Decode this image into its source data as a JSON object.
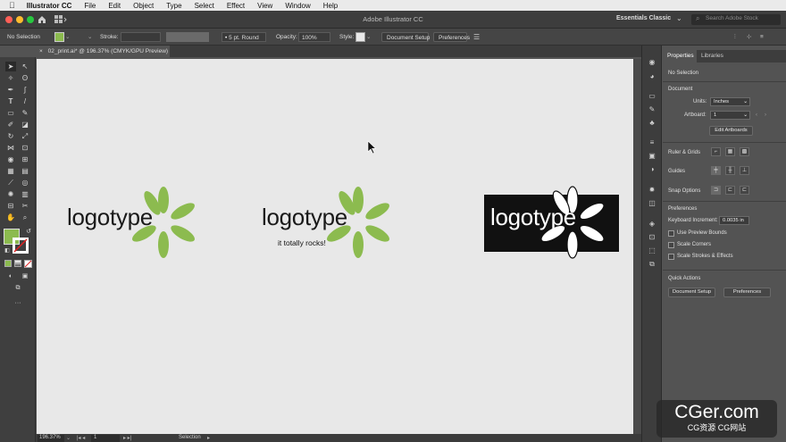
{
  "menubar": {
    "apple": "",
    "app_name": "Illustrator CC",
    "items": [
      "File",
      "Edit",
      "Object",
      "Type",
      "Select",
      "Effect",
      "View",
      "Window",
      "Help"
    ]
  },
  "app_header": {
    "title": "Adobe Illustrator CC",
    "workspace": "Essentials Classic",
    "search_placeholder": "Search Adobe Stock"
  },
  "control_bar": {
    "selection_status": "No Selection",
    "stroke_label": "Stroke:",
    "brush_value": "5 pt. Round",
    "opacity_label": "Opacity:",
    "opacity_value": "100%",
    "style_label": "Style:",
    "document_setup": "Document Setup",
    "preferences": "Preferences"
  },
  "document_tab": {
    "label": "02_print.ai* @ 196.37% (CMYK/GPU Preview)",
    "close": "×"
  },
  "canvas": {
    "logos": [
      {
        "text": "logotype",
        "tagline": "",
        "inverted": false
      },
      {
        "text": "logotype",
        "tagline": "it totally rocks!",
        "inverted": false
      },
      {
        "text": "logotype",
        "tagline": "",
        "inverted": true
      }
    ],
    "colors": {
      "leaf": "#8cbb4f",
      "text": "#1a1a1a",
      "dark_bg": "#111111",
      "canvas": "#e8e8e8"
    }
  },
  "status_bar": {
    "zoom": "196.37%",
    "artboard": "1",
    "tool": "Selection"
  },
  "properties_panel": {
    "tabs": [
      "Properties",
      "Libraries"
    ],
    "selection": "No Selection",
    "document_heading": "Document",
    "units_label": "Units:",
    "units_value": "Inches",
    "artboard_label": "Artboard:",
    "artboard_value": "1",
    "edit_artboards": "Edit Artboards",
    "ruler_grids": "Ruler & Grids",
    "guides": "Guides",
    "snap_options": "Snap Options",
    "preferences_heading": "Preferences",
    "keyboard_increment_label": "Keyboard Increment:",
    "keyboard_increment_value": "0.0035 in",
    "use_preview_bounds": "Use Preview Bounds",
    "scale_corners": "Scale Corners",
    "scale_strokes": "Scale Strokes & Effects",
    "quick_actions": "Quick Actions",
    "qa_document_setup": "Document Setup",
    "qa_preferences": "Preferences"
  },
  "watermark": {
    "big": "CGer.com",
    "small": "CG资源  CG网站"
  }
}
